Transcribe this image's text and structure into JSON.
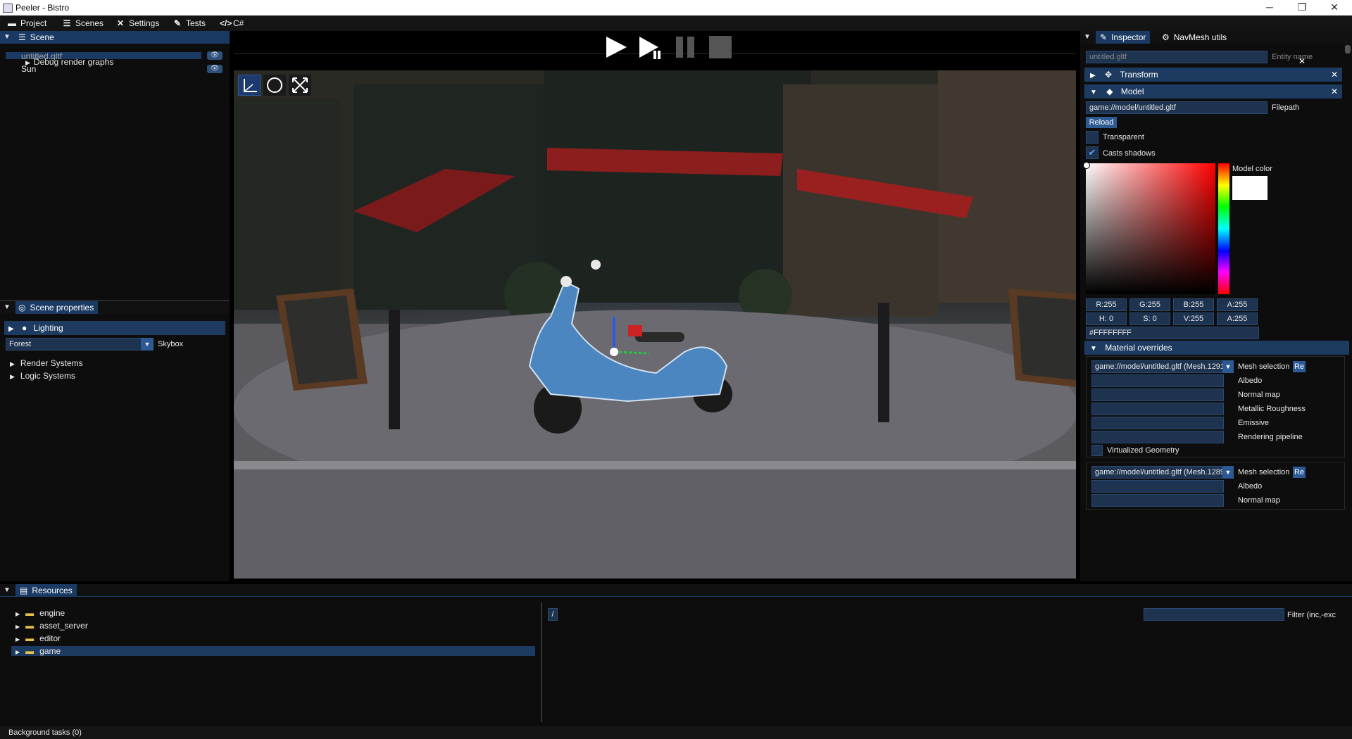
{
  "window": {
    "title": "Peeler - Bistro",
    "minimize": "─",
    "maximize": "❐",
    "close": "✕"
  },
  "menu": [
    {
      "label": "Project",
      "icon": "folder-open-icon"
    },
    {
      "label": "Scenes",
      "icon": "list-icon"
    },
    {
      "label": "Settings",
      "icon": "tools-icon"
    },
    {
      "label": "Tests",
      "icon": "wrench-icon"
    },
    {
      "label": "C#",
      "icon": "code-icon"
    }
  ],
  "scene_panel": {
    "tab": "Scene",
    "items": [
      {
        "label": "untitled.gltf"
      },
      {
        "label": "Sun"
      }
    ],
    "debug_popup": "Debug render graphs"
  },
  "scene_properties": {
    "tab": "Scene properties",
    "lighting": "Lighting",
    "skybox_value": "Forest",
    "skybox_label": "Skybox",
    "render_systems": "Render Systems",
    "logic_systems": "Logic Systems"
  },
  "inspector": {
    "tab_inspector": "Inspector",
    "tab_navmesh": "NavMesh utils",
    "entity_name_value": "untitled.gltf",
    "entity_name_placeholder": "Entity name",
    "transform": "Transform",
    "model": "Model",
    "filepath_value": "game://model/untitled.gltf",
    "filepath_label": "Filepath",
    "reload": "Reload",
    "transparent": "Transparent",
    "casts_shadows": "Casts shadows",
    "casts_shadows_checked": true,
    "model_color_label": "Model color",
    "model_color": "#FFFFFF",
    "rgba": {
      "r": "R:255",
      "g": "G:255",
      "b": "B:255",
      "a": "A:255"
    },
    "hsva": {
      "h": "H: 0",
      "s": "S: 0",
      "v": "V:255",
      "a": "A:255"
    },
    "hex": "#FFFFFFFF",
    "material_overrides": "Material overrides",
    "overrides": [
      {
        "mesh": "game://model/untitled.gltf (Mesh.1291",
        "mesh_label": "Mesh selection",
        "reset": "Re",
        "fields": [
          "Albedo",
          "Normal map",
          "Metallic Roughness",
          "Emissive",
          "Rendering pipeline"
        ],
        "virtualized": "Virtualized Geometry"
      },
      {
        "mesh": "game://model/untitled.gltf (Mesh.1289",
        "mesh_label": "Mesh selection",
        "reset": "Re",
        "fields": [
          "Albedo",
          "Normal map"
        ]
      }
    ]
  },
  "resources": {
    "tab": "Resources",
    "folders": [
      "engine",
      "asset_server",
      "editor",
      "game"
    ],
    "selected_folder": "game",
    "path": "/",
    "filter_label": "Filter (inc,-exc"
  },
  "status": {
    "background_tasks": "Background tasks (0)"
  },
  "colors": {
    "accent": "#1b3a63",
    "selection": "#1d3a60",
    "field": "#1d3350"
  }
}
